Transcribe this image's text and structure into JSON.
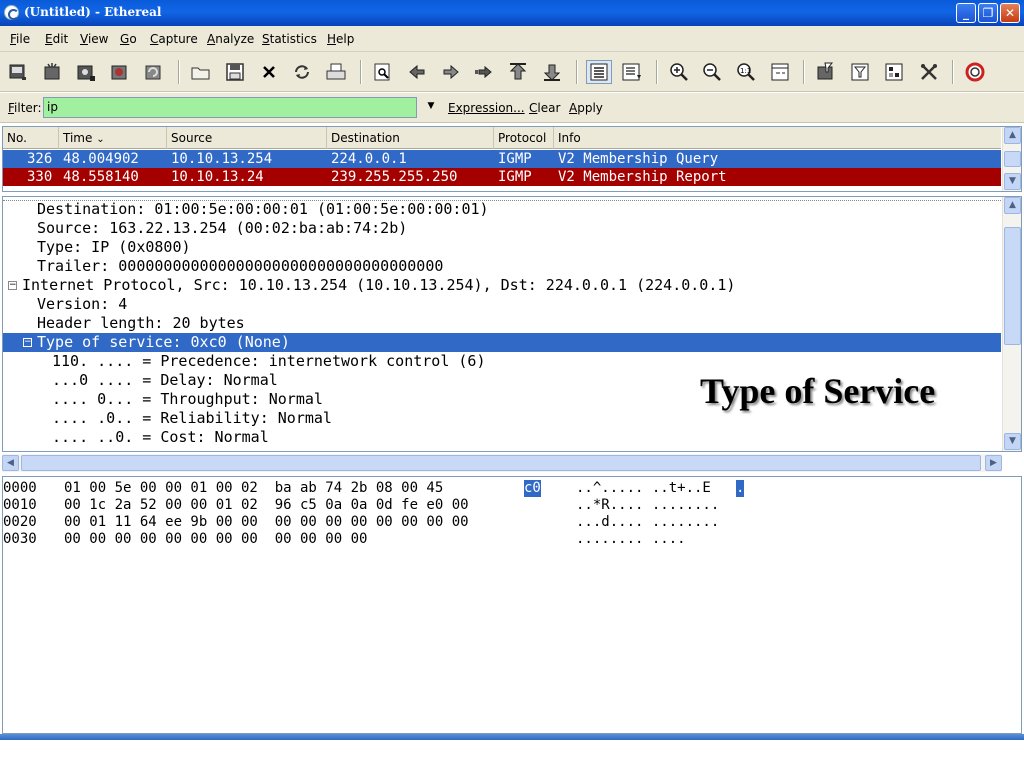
{
  "window": {
    "title": "(Untitled) - Ethereal",
    "minimize": "_",
    "maximize": "❐",
    "close": "✕"
  },
  "menu": [
    {
      "pre": "",
      "u": "F",
      "post": "ile"
    },
    {
      "pre": "",
      "u": "E",
      "post": "dit"
    },
    {
      "pre": "",
      "u": "V",
      "post": "iew"
    },
    {
      "pre": "",
      "u": "G",
      "post": "o"
    },
    {
      "pre": "",
      "u": "C",
      "post": "apture"
    },
    {
      "pre": "",
      "u": "A",
      "post": "nalyze"
    },
    {
      "pre": "",
      "u": "S",
      "post": "tatistics"
    },
    {
      "pre": "",
      "u": "H",
      "post": "elp"
    }
  ],
  "toolbar": {
    "icons": [
      "interfaces-icon",
      "capture-options-icon",
      "start-capture-icon",
      "stop-capture-icon",
      "restart-capture-icon",
      "open-file-icon",
      "save-file-icon",
      "close-file-icon",
      "reload-icon",
      "print-icon",
      "find-packet-icon",
      "go-back-icon",
      "go-forward-icon",
      "go-to-packet-icon",
      "go-first-icon",
      "go-last-icon",
      "colorize-icon",
      "auto-scroll-icon",
      "zoom-in-icon",
      "zoom-out-icon",
      "zoom-normal-icon",
      "resize-columns-icon",
      "capture-filters-icon",
      "display-filters-icon",
      "coloring-rules-icon",
      "preferences-icon",
      "help-icon"
    ]
  },
  "filter": {
    "label_u": "F",
    "label_rest": "ilter:",
    "value": "ip",
    "dropdown": "▼",
    "expression": "Expression...",
    "clear_u": "C",
    "clear_rest": "lear",
    "apply_u": "A",
    "apply_rest": "pply"
  },
  "packet_list": {
    "columns": [
      "No.",
      "Time",
      "Source",
      "Destination",
      "Protocol",
      "Info"
    ],
    "sort_indicator": "⌄",
    "rows": [
      {
        "no": "326",
        "time": "48.004902",
        "source": "10.10.13.254",
        "destination": "224.0.0.1",
        "protocol": "IGMP",
        "info": "V2 Membership Query",
        "style": "sel"
      },
      {
        "no": "330",
        "time": "48.558140",
        "source": "10.10.13.24",
        "destination": "239.255.255.250",
        "protocol": "IGMP",
        "info": "V2 Membership Report",
        "style": "red"
      }
    ]
  },
  "details": {
    "lines": [
      {
        "text": "Destination: 01:00:5e:00:00:01 (01:00:5e:00:00:01)",
        "indent": 2,
        "expander": "",
        "highlight": false
      },
      {
        "text": "Source: 163.22.13.254 (00:02:ba:ab:74:2b)",
        "indent": 2,
        "expander": "",
        "highlight": false
      },
      {
        "text": "Type: IP (0x0800)",
        "indent": 2,
        "expander": "",
        "highlight": false
      },
      {
        "text": "Trailer: 000000000000000000000000000000000000",
        "indent": 2,
        "expander": "",
        "highlight": false
      },
      {
        "text": "Internet Protocol, Src: 10.10.13.254 (10.10.13.254), Dst: 224.0.0.1 (224.0.0.1)",
        "indent": 1,
        "expander": "−",
        "highlight": false
      },
      {
        "text": "Version: 4",
        "indent": 2,
        "expander": "",
        "highlight": false
      },
      {
        "text": "Header length: 20 bytes",
        "indent": 2,
        "expander": "",
        "highlight": false
      },
      {
        "text": "Type of service: 0xc0 (None)",
        "indent": 2,
        "expander": "−",
        "highlight": true
      },
      {
        "text": "110. .... = Precedence: internetwork control (6)",
        "indent": 3,
        "expander": "",
        "highlight": false
      },
      {
        "text": "...0 .... = Delay: Normal",
        "indent": 3,
        "expander": "",
        "highlight": false
      },
      {
        "text": ".... 0... = Throughput: Normal",
        "indent": 3,
        "expander": "",
        "highlight": false
      },
      {
        "text": ".... .0.. = Reliability: Normal",
        "indent": 3,
        "expander": "",
        "highlight": false
      },
      {
        "text": ".... ..0. = Cost: Normal",
        "indent": 3,
        "expander": "",
        "highlight": false
      }
    ]
  },
  "annotation": "Type of Service",
  "hex": {
    "lines": [
      {
        "offset": "0000",
        "bytes_pre": "01 00 5e 00 00 01 00 02  ba ab 74 2b 08 00 45 ",
        "bytes_sel": "c0",
        "ascii_pre": "..^..... ..t+..E",
        "ascii_sel": "."
      },
      {
        "offset": "0010",
        "bytes_pre": "00 1c 2a 52 00 00 01 02  96 c5 0a 0a 0d fe e0 00",
        "bytes_sel": "",
        "ascii_pre": "..*R.... ........",
        "ascii_sel": ""
      },
      {
        "offset": "0020",
        "bytes_pre": "00 01 11 64 ee 9b 00 00  00 00 00 00 00 00 00 00",
        "bytes_sel": "",
        "ascii_pre": "...d.... ........",
        "ascii_sel": ""
      },
      {
        "offset": "0030",
        "bytes_pre": "00 00 00 00 00 00 00 00  00 00 00 00",
        "bytes_sel": "",
        "ascii_pre": "........ ....",
        "ascii_sel": ""
      }
    ]
  }
}
